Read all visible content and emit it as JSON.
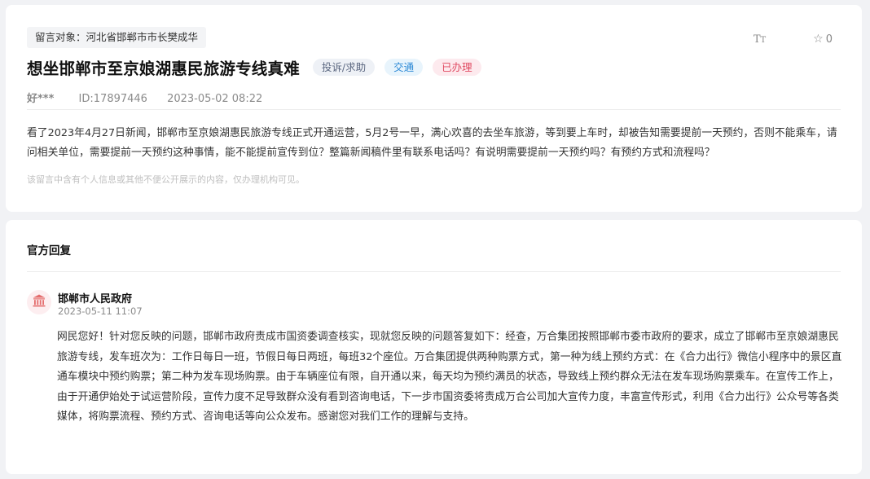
{
  "message": {
    "target_label": "留言对象：",
    "target_name": "河北省邯郸市市长樊成华",
    "title": "想坐邯郸市至京娘湖惠民旅游专线真难",
    "tags": [
      "投诉/求助",
      "交通",
      "已办理"
    ],
    "author": "好***",
    "id_text": "ID:17897446",
    "datetime": "2023-05-02 08:22",
    "body": "看了2023年4月27日新闻，邯郸市至京娘湖惠民旅游专线正式开通运营，5月2号一早，满心欢喜的去坐车旅游，等到要上车时，却被告知需要提前一天预约，否则不能乘车，请问相关单位，需要提前一天预约这种事情，能不能提前宣传到位？整篇新闻稿件里有联系电话吗？有说明需要提前一天预约吗？有预约方式和流程吗？",
    "privacy_notice": "该留言中含有个人信息或其他不便公开展示的内容，仅办理机构可见。"
  },
  "toolbar": {
    "font_size_label": "TT",
    "favorite_count": "0"
  },
  "reply": {
    "heading": "官方回复",
    "org_name": "邯郸市人民政府",
    "datetime": "2023-05-11 11:07",
    "body": "网民您好！针对您反映的问题，邯郸市政府责成市国资委调查核实，现就您反映的问题答复如下：经查，万合集团按照邯郸市委市政府的要求，成立了邯郸市至京娘湖惠民旅游专线，发车班次为：工作日每日一班，节假日每日两班，每班32个座位。万合集团提供两种购票方式，第一种为线上预约方式：在《合力出行》微信小程序中的景区直通车模块中预约购票；第二种为发车现场购票。由于车辆座位有限，自开通以来，每天均为预约满员的状态，导致线上预约群众无法在发车现场购票乘车。在宣传工作上，由于开通伊始处于试运营阶段，宣传力度不足导致群众没有看到咨询电话，下一步市国资委将责成万合公司加大宣传力度，丰富宣传形式，利用《合力出行》公众号等各类媒体，将购票流程、预约方式、咨询电话等向公众发布。感谢您对我们工作的理解与支持。"
  },
  "colors": {
    "tag_gray_text": "#5b6780",
    "tag_blue_text": "#2e8ad6",
    "tag_red_text": "#e04b62",
    "avatar_icon": "#e46d6d"
  },
  "icons": {
    "font_size": "font-size-icon",
    "favorite": "star-icon",
    "organization": "government-building-icon"
  }
}
